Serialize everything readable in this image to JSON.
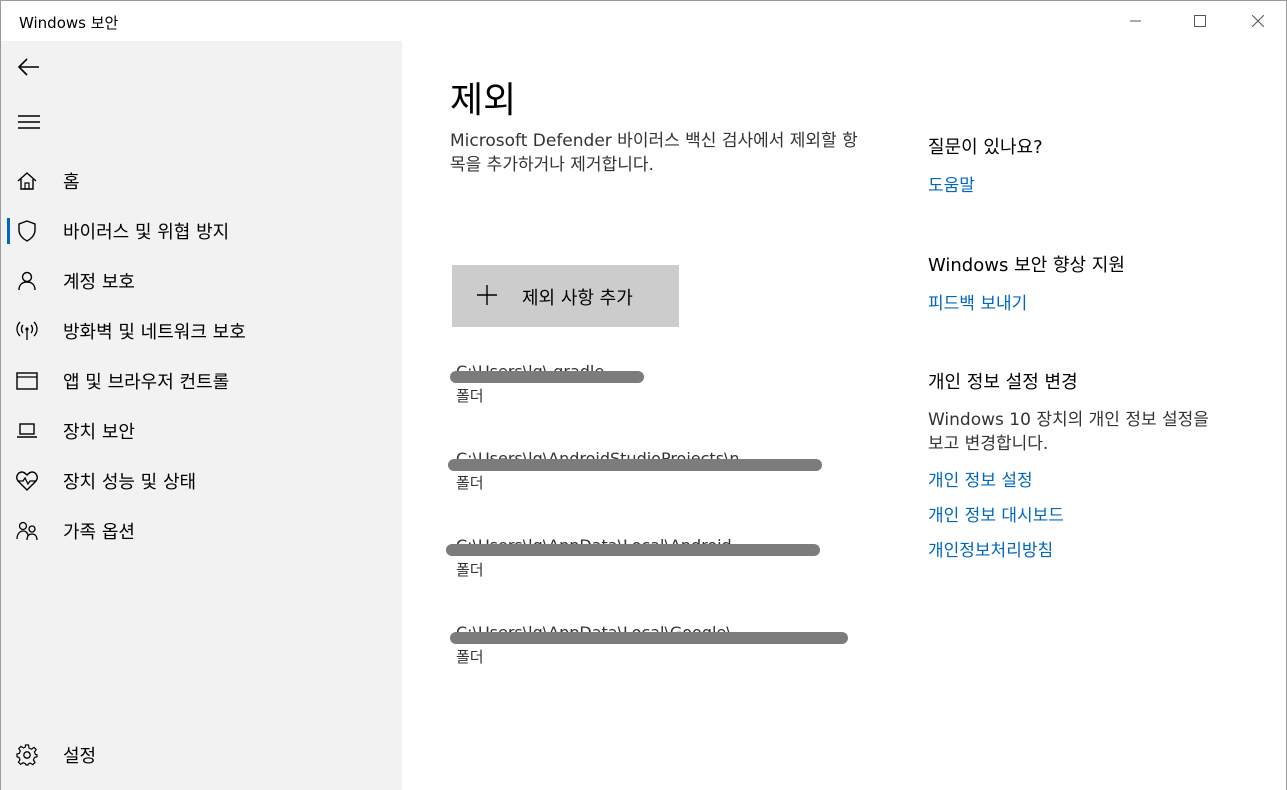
{
  "window": {
    "title": "Windows 보안"
  },
  "sidebar": {
    "items": [
      {
        "label": "홈",
        "icon": "home-icon"
      },
      {
        "label": "바이러스 및 위협 방지",
        "icon": "shield-icon",
        "active": true
      },
      {
        "label": "계정 보호",
        "icon": "person-icon"
      },
      {
        "label": "방화벽 및 네트워크 보호",
        "icon": "wireless-icon"
      },
      {
        "label": "앱 및 브라우저 컨트롤",
        "icon": "browser-window-icon"
      },
      {
        "label": "장치 보안",
        "icon": "laptop-icon"
      },
      {
        "label": "장치 성능 및 상태",
        "icon": "heart-pulse-icon"
      },
      {
        "label": "가족 옵션",
        "icon": "family-icon"
      }
    ],
    "settings_label": "설정"
  },
  "main": {
    "title": "제외",
    "description": "Microsoft Defender 바이러스 백신 검사에서 제외할 항목을 추가하거나 제거합니다.",
    "add_button_label": "제외 사항 추가",
    "exclusions": [
      {
        "path": "C:\\Users\\lg\\.gradle",
        "type": "폴더"
      },
      {
        "path": "C:\\Users\\lg\\AndroidStudioProjects\\n",
        "type": "폴더"
      },
      {
        "path": "C:\\Users\\lg\\AppData\\Local\\Android",
        "type": "폴더"
      },
      {
        "path": "C:\\Users\\lg\\AppData\\Local\\Google\\",
        "type": "폴더"
      }
    ]
  },
  "right": {
    "question_heading": "질문이 있나요?",
    "help_link": "도움말",
    "improve_heading": "Windows 보안 향상 지원",
    "feedback_link": "피드백 보내기",
    "privacy_heading": "개인 정보 설정 변경",
    "privacy_text": "Windows 10 장치의 개인 정보 설정을 보고 변경합니다.",
    "privacy_links": [
      "개인 정보 설정",
      "개인 정보 대시보드",
      "개인정보처리방침"
    ]
  },
  "colors": {
    "accent": "#0067c0",
    "sidebar_bg": "#f2f2f2",
    "button_bg": "#cccccc"
  }
}
